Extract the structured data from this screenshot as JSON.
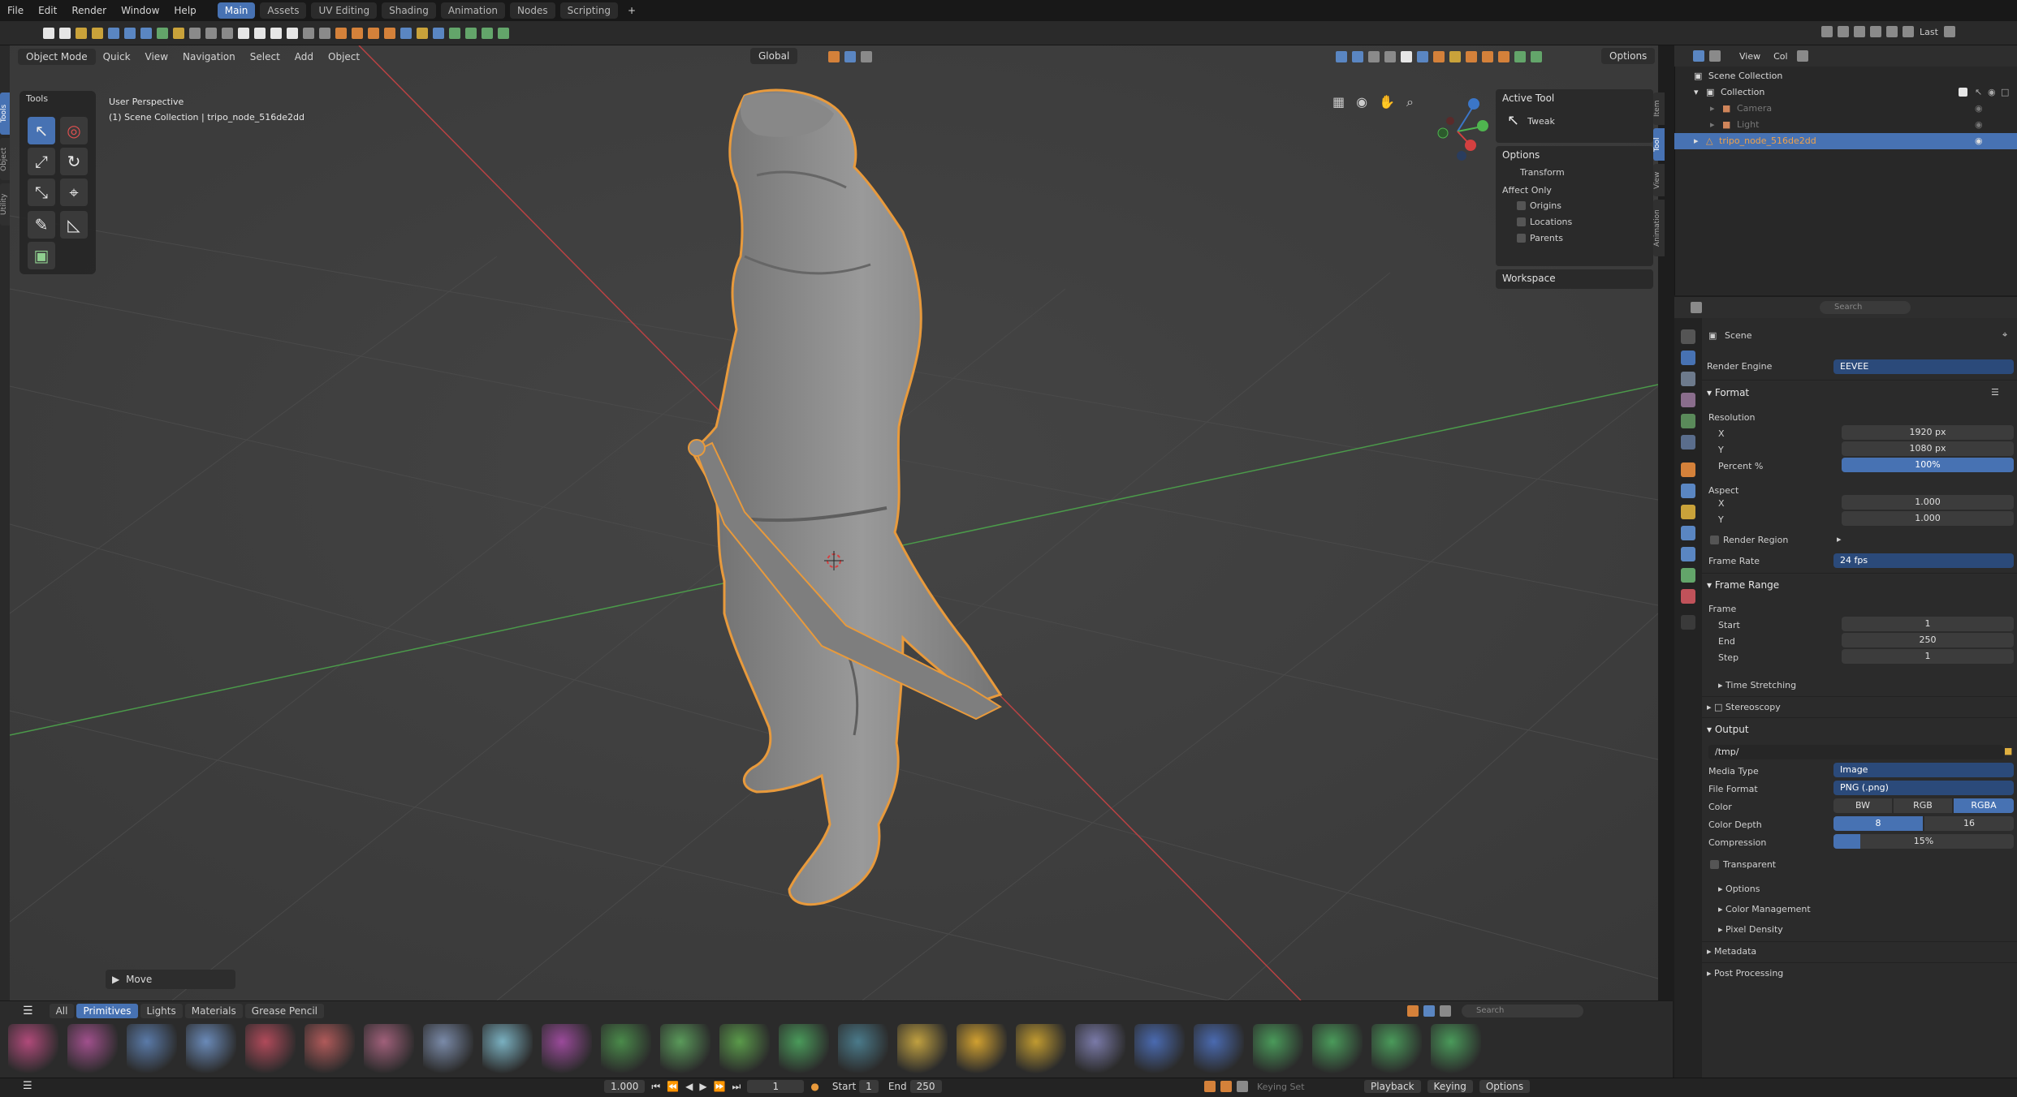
{
  "menubar": {
    "menus": [
      "File",
      "Edit",
      "Render",
      "Window",
      "Help"
    ],
    "workspaces": [
      "Main",
      "Assets",
      "UV Editing",
      "Shading",
      "Animation",
      "Nodes",
      "Scripting"
    ],
    "active_workspace": "Main",
    "add_workspace": "+"
  },
  "viewport_header": {
    "mode": "Object Mode",
    "menus": [
      "Quick",
      "View",
      "Navigation",
      "Select",
      "Add",
      "Object"
    ],
    "orientation": "Global",
    "options": "Options"
  },
  "viewport": {
    "perspective": "User Perspective",
    "collection_line": "(1) Scene Collection | tripo_node_516de2dd",
    "object_outline_color": "#e89a3c",
    "x_axis_color": "#c0393b",
    "y_axis_color": "#3fa33f"
  },
  "left_tabs": [
    "Tools",
    "Object",
    "Utility"
  ],
  "tools_panel": {
    "title": "Tools",
    "tools": [
      "select-tweak-icon",
      "cursor-icon",
      "move-icon",
      "rotate-icon",
      "scale-icon",
      "transform-icon",
      "annotate-icon",
      "measure-icon",
      "add-cube-icon"
    ]
  },
  "npanel": {
    "tabs": [
      "Item",
      "Tool",
      "View",
      "Animation"
    ],
    "active_tool_title": "Active Tool",
    "active_tool_name": "Tweak",
    "options_title": "Options",
    "transform_label": "Transform",
    "affect_only_label": "Affect Only",
    "affect_items": [
      "Origins",
      "Locations",
      "Parents"
    ],
    "workspace_label": "Workspace"
  },
  "move_panel": {
    "label": "Move"
  },
  "assetbar": {
    "tabs": [
      "All",
      "Primitives",
      "Lights",
      "Materials",
      "Grease Pencil"
    ],
    "active_tab": "Primitives",
    "search_placeholder": "Search"
  },
  "timeline": {
    "speed": "1.000",
    "current_frame": "1",
    "start_label": "Start",
    "start_value": "1",
    "end_label": "End",
    "end_value": "250",
    "keying_set_placeholder": "Keying Set",
    "playback": "Playback",
    "keying": "Keying",
    "options": "Options"
  },
  "topbar_right": {
    "layer_label": "Last"
  },
  "outliner": {
    "header_menus": [
      "View",
      "Col"
    ],
    "rows": [
      {
        "label": "Scene Collection",
        "indent": 0
      },
      {
        "label": "Collection",
        "indent": 1
      },
      {
        "label": "Camera",
        "indent": 2
      },
      {
        "label": "Light",
        "indent": 2
      },
      {
        "label": "tripo_node_516de2dd",
        "indent": 1
      }
    ]
  },
  "properties": {
    "search_placeholder": "Search",
    "context": "Scene",
    "render_engine_label": "Render Engine",
    "render_engine": "EEVEE",
    "format_title": "Format",
    "resolution_label": "Resolution",
    "res_x_label": "X",
    "res_x": "1920 px",
    "res_y_label": "Y",
    "res_y": "1080 px",
    "percent_label": "Percent %",
    "percent": "100%",
    "aspect_label": "Aspect",
    "aspect_x_label": "X",
    "aspect_x": "1.000",
    "aspect_y_label": "Y",
    "aspect_y": "1.000",
    "render_region_label": "Render Region",
    "frame_rate_label": "Frame Rate",
    "frame_rate": "24 fps",
    "frame_range_title": "Frame Range",
    "frame_label": "Frame",
    "start_label": "Start",
    "start": "1",
    "end_label": "End",
    "end": "250",
    "step_label": "Step",
    "step": "1",
    "time_stretching": "Time Stretching",
    "stereoscopy": "Stereoscopy",
    "output_title": "Output",
    "output_path": "/tmp/",
    "media_type_label": "Media Type",
    "media_type": "Image",
    "file_format_label": "File Format",
    "file_format": "PNG (.png)",
    "color_label": "Color",
    "color_options": [
      "BW",
      "RGB",
      "RGBA"
    ],
    "color_selected": "RGBA",
    "color_depth_label": "Color Depth",
    "color_depth_options": [
      "8",
      "16"
    ],
    "color_depth_selected": "8",
    "compression_label": "Compression",
    "compression": "15%",
    "compression_fraction": 0.15,
    "transparent_label": "Transparent",
    "options_sub": "Options",
    "color_management": "Color Management",
    "pixel_density": "Pixel Density",
    "metadata": "Metadata",
    "post_processing": "Post Processing"
  }
}
